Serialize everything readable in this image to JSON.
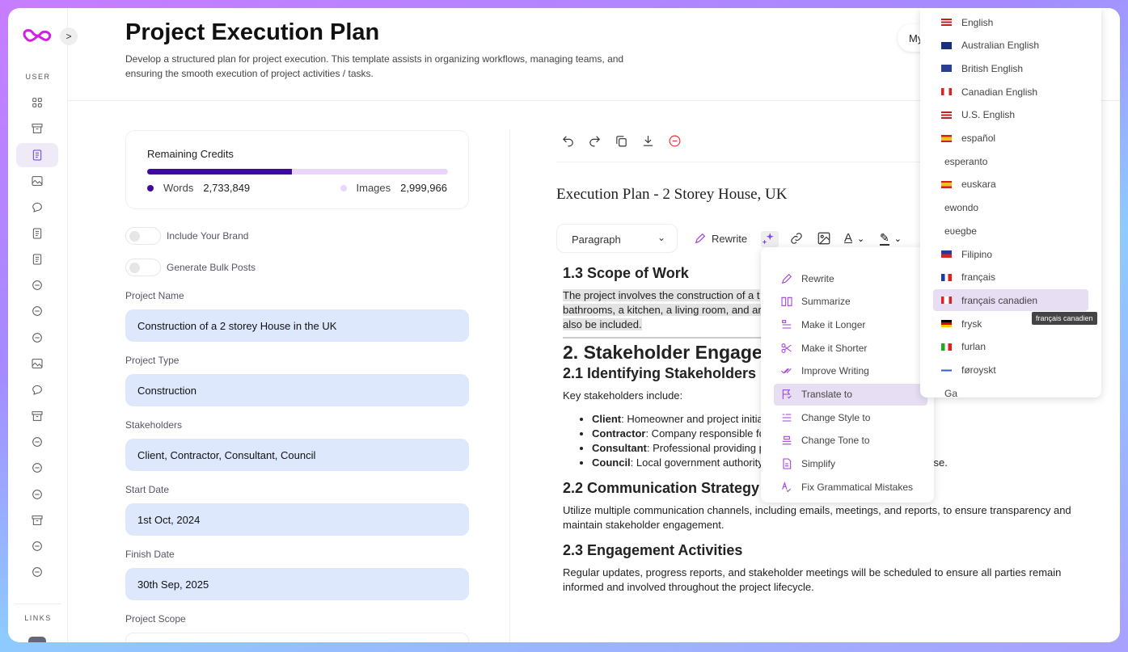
{
  "sidebar": {
    "user_label": "USER",
    "links_label": "LINKS",
    "active": "documents",
    "icons": [
      "grid-icon",
      "archive-icon",
      "document-icon",
      "image-icon",
      "chat-icon",
      "article-icon",
      "edit-document-icon",
      "scan-icon",
      "web-icon",
      "pen-icon",
      "image-gallery-icon",
      "message-icon",
      "terminal-icon",
      "microphone-icon",
      "speaker-icon",
      "add-user-icon",
      "board-icon",
      "dollar-icon",
      "support-icon"
    ]
  },
  "header": {
    "title": "Project Execution Plan",
    "description": "Develop a structured plan for project execution. This template assists in organizing workflows, managing teams, and ensuring the smooth execution of project activities / tasks.",
    "my_button": "My"
  },
  "credits": {
    "title": "Remaining Credits",
    "words_label": "Words",
    "words_value": "2,733,849",
    "images_label": "Images",
    "images_value": "2,999,966",
    "words_fraction_percent": 48,
    "colors": {
      "words": "#3f0a9e",
      "images": "#ead5fb"
    }
  },
  "toggles": [
    {
      "label": "Include Your Brand",
      "on": false
    },
    {
      "label": "Generate Bulk Posts",
      "on": false
    }
  ],
  "fields": [
    {
      "label": "Project Name",
      "value": "Construction of a 2 storey House in the UK"
    },
    {
      "label": "Project Type",
      "value": "Construction"
    },
    {
      "label": "Stakeholders",
      "value": "Client, Contractor, Consultant, Council"
    },
    {
      "label": "Start Date",
      "value": "1st Oct, 2024"
    },
    {
      "label": "Finish Date",
      "value": "30th Sep, 2025"
    },
    {
      "label": "Project Scope",
      "value": ""
    }
  ],
  "editor": {
    "title": "Execution Plan - 2 Storey House, UK",
    "block_type": "Paragraph",
    "rewrite_label": "Rewrite",
    "h_scope": "1.3 Scope of Work",
    "scope_lines": [
      "The project involves the construction of a t",
      "bathrooms, a kitchen, a living room, and ar",
      "also be included."
    ],
    "h_stake": "2. Stakeholder Engagement",
    "h_ident": "2.1 Identifying Stakeholders",
    "key_intro": "Key stakeholders include:",
    "bullets": [
      {
        "b": "Client",
        "t": ": Homeowner and project initia"
      },
      {
        "b": "Contractor",
        "t": ": Company responsible fo"
      },
      {
        "b": "Consultant",
        "t": ": Professional providing p",
        "end": "tise."
      },
      {
        "b": "Council",
        "t": ": Local government authority"
      }
    ],
    "h_comm": "2.2 Communication Strategy",
    "comm_text": "Utilize multiple communication channels, including emails, meetings, and reports, to ensure transparency and maintain stakeholder engagement.",
    "h_act": "2.3 Engagement Activities",
    "act_text": "Regular updates, progress reports, and stakeholder meetings will be scheduled to ensure all parties remain informed and involved throughout the project lifecycle."
  },
  "ai_menu": {
    "highlighted": "Translate to",
    "items": [
      "Rewrite",
      "Summarize",
      "Make it Longer",
      "Make it Shorter",
      "Improve Writing",
      "Translate to",
      "Change Style to",
      "Change Tone to",
      "Simplify",
      "Fix Grammatical Mistakes"
    ]
  },
  "languages": {
    "highlighted": "français canadien",
    "tooltip": "français canadien",
    "items": [
      {
        "name": "English",
        "flag": "us"
      },
      {
        "name": "Australian English",
        "flag": "au"
      },
      {
        "name": "British English",
        "flag": "gb"
      },
      {
        "name": "Canadian English",
        "flag": "ca"
      },
      {
        "name": "U.S. English",
        "flag": "us"
      },
      {
        "name": "español",
        "flag": "es"
      },
      {
        "name": "esperanto",
        "flag": ""
      },
      {
        "name": "euskara",
        "flag": "es"
      },
      {
        "name": "ewondo",
        "flag": ""
      },
      {
        "name": "eʋegbe",
        "flag": ""
      },
      {
        "name": "Filipino",
        "flag": "ph"
      },
      {
        "name": "français",
        "flag": "fr"
      },
      {
        "name": "français canadien",
        "flag": "ca"
      },
      {
        "name": "frysk",
        "flag": "de"
      },
      {
        "name": "furlan",
        "flag": "it"
      },
      {
        "name": "føroyskt",
        "flag": "fo"
      },
      {
        "name": "Ga",
        "flag": ""
      }
    ]
  }
}
